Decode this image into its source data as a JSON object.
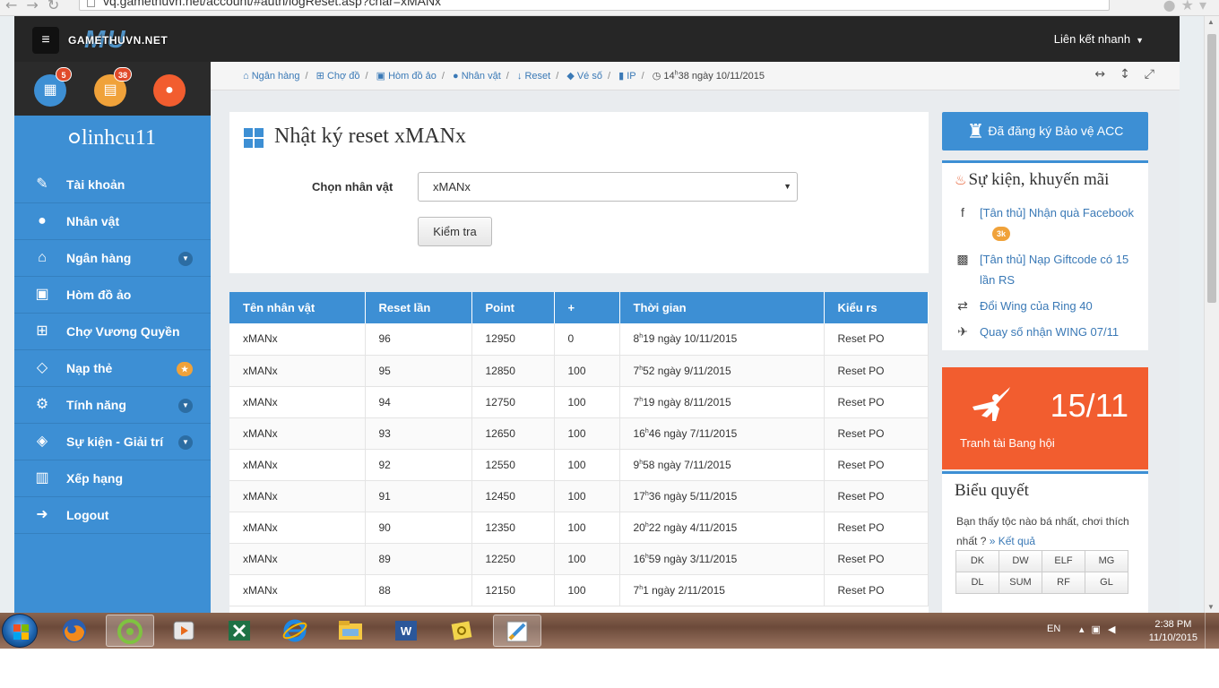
{
  "browser": {
    "url": "vq.gamethuvn.net/account/#auth/logReset.asp?char=xMANx"
  },
  "header": {
    "logo_text": "GAMETHUVN.NET",
    "logo_mark": "MU",
    "quick_links": "Liên kết nhanh"
  },
  "sidebar": {
    "badges": {
      "calendar": "5",
      "cards": "38"
    },
    "username": "linhcu11",
    "items": [
      {
        "label": "Tài khoản",
        "icon": "edit-icon"
      },
      {
        "label": "Nhân vật",
        "icon": "user-icon"
      },
      {
        "label": "Ngân hàng",
        "icon": "bank-icon"
      },
      {
        "label": "Hòm đồ ảo",
        "icon": "briefcase-icon"
      },
      {
        "label": "Chợ Vương Quyền",
        "icon": "cart-icon"
      },
      {
        "label": "Nạp thẻ",
        "icon": "diamond-icon"
      },
      {
        "label": "Tính năng",
        "icon": "cogs-icon"
      },
      {
        "label": "Sự kiện - Giải trí",
        "icon": "gamepad-icon"
      },
      {
        "label": "Xếp hạng",
        "icon": "bar-chart-icon"
      },
      {
        "label": "Logout",
        "icon": "logout-icon"
      }
    ]
  },
  "breadcrumb": {
    "items": [
      "Ngân hàng",
      "Chợ đồ",
      "Hòm đồ ảo",
      "Nhân vật",
      "Reset",
      "Vé số",
      "IP"
    ],
    "clock_hour": "14",
    "clock_h": "h",
    "clock_rest": "38 ngày 10/11/2015"
  },
  "main": {
    "title": "Nhật ký reset xMANx",
    "select_label": "Chọn nhân vật",
    "select_value": "xMANx",
    "check_button": "Kiểm tra"
  },
  "table": {
    "headers": [
      "Tên nhân vật",
      "Reset lần",
      "Point",
      "+",
      "Thời gian",
      "Kiểu rs"
    ],
    "rows": [
      {
        "name": "xMANx",
        "reset": "96",
        "point": "12950",
        "plus": "0",
        "hour": "8",
        "time": "19 ngày 10/11/2015",
        "type": "Reset PO"
      },
      {
        "name": "xMANx",
        "reset": "95",
        "point": "12850",
        "plus": "100",
        "hour": "7",
        "time": "52 ngày 9/11/2015",
        "type": "Reset PO"
      },
      {
        "name": "xMANx",
        "reset": "94",
        "point": "12750",
        "plus": "100",
        "hour": "7",
        "time": "19 ngày 8/11/2015",
        "type": "Reset PO"
      },
      {
        "name": "xMANx",
        "reset": "93",
        "point": "12650",
        "plus": "100",
        "hour": "16",
        "time": "46 ngày 7/11/2015",
        "type": "Reset PO"
      },
      {
        "name": "xMANx",
        "reset": "92",
        "point": "12550",
        "plus": "100",
        "hour": "9",
        "time": "58 ngày 7/11/2015",
        "type": "Reset PO"
      },
      {
        "name": "xMANx",
        "reset": "91",
        "point": "12450",
        "plus": "100",
        "hour": "17",
        "time": "36 ngày 5/11/2015",
        "type": "Reset PO"
      },
      {
        "name": "xMANx",
        "reset": "90",
        "point": "12350",
        "plus": "100",
        "hour": "20",
        "time": "22 ngày 4/11/2015",
        "type": "Reset PO"
      },
      {
        "name": "xMANx",
        "reset": "89",
        "point": "12250",
        "plus": "100",
        "hour": "16",
        "time": "59 ngày 3/11/2015",
        "type": "Reset PO"
      },
      {
        "name": "xMANx",
        "reset": "88",
        "point": "12150",
        "plus": "100",
        "hour": "7",
        "time": "1 ngày 2/11/2015",
        "type": "Reset PO"
      }
    ],
    "hour_suffix": "h"
  },
  "right": {
    "protect_label": "Đã đăng ký Bảo vệ ACC",
    "events_title": "Sự kiện, khuyến mãi",
    "events": [
      {
        "text": "[Tân thủ] Nhận quà Facebook",
        "tag": "3k",
        "icon": "facebook-icon"
      },
      {
        "text": "[Tân thủ] Nạp Giftcode có 15 lần RS",
        "icon": "gift-icon"
      },
      {
        "text": "Đổi Wing của Ring 40",
        "icon": "exchange-icon"
      },
      {
        "text": "Quay số nhận WING 07/11",
        "icon": "plane-icon"
      }
    ],
    "guild_war_date": "15/11",
    "guild_war_caption": "Tranh tài Bang hội",
    "poll_title": "Biểu quyết",
    "poll_question": "Bạn thấy tộc nào bá nhất, chơi thích nhất ?",
    "poll_result": "» Kết quả",
    "poll_options": [
      "DK",
      "DW",
      "ELF",
      "MG",
      "DL",
      "SUM",
      "RF",
      "GL"
    ]
  },
  "taskbar": {
    "lang": "EN",
    "time": "2:38 PM",
    "date": "11/10/2015"
  }
}
